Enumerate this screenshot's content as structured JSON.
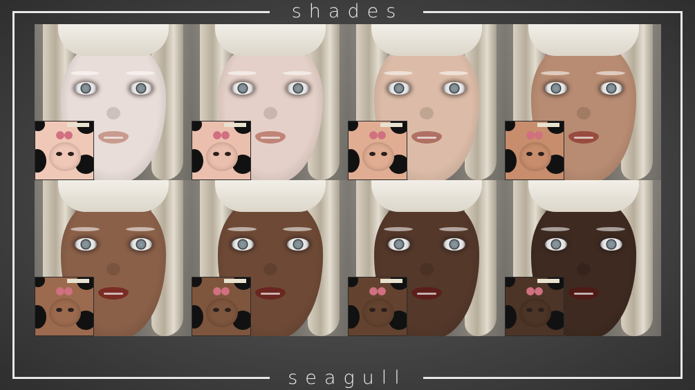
{
  "header": {
    "title": "shades"
  },
  "footer": {
    "title": "seagull"
  },
  "shades": [
    {
      "skin": "#e8ddd8",
      "lips": "#c99a8e",
      "swatch": "#f0c8b8"
    },
    {
      "skin": "#e4d0c8",
      "lips": "#c08578",
      "swatch": "#ebbfae"
    },
    {
      "skin": "#dcbca8",
      "lips": "#b07064",
      "swatch": "#e0ad92"
    },
    {
      "skin": "#b88c72",
      "lips": "#984c40",
      "swatch": "#c78d6c"
    },
    {
      "skin": "#8a6048",
      "lips": "#7a2c24",
      "swatch": "#9c6a4e"
    },
    {
      "skin": "#6e4a36",
      "lips": "#6a2620",
      "swatch": "#7e553d"
    },
    {
      "skin": "#54382a",
      "lips": "#5c1e1a",
      "swatch": "#63432f"
    },
    {
      "skin": "#3e2a20",
      "lips": "#4e1a16",
      "swatch": "#4c3426"
    }
  ]
}
